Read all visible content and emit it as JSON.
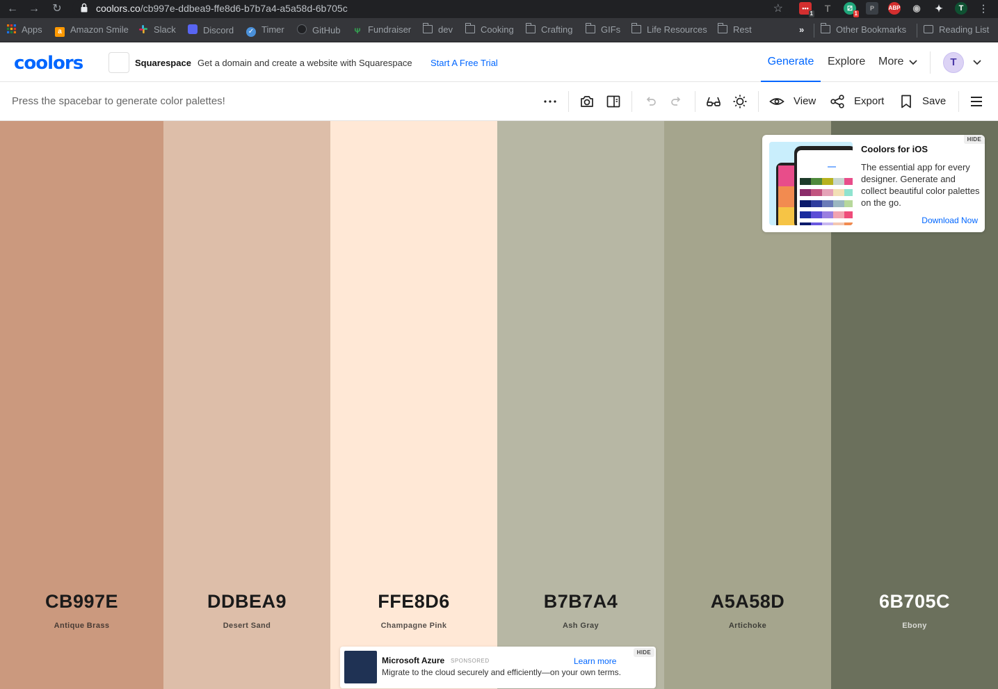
{
  "browser": {
    "url_host": "coolors.co",
    "url_path": "/cb997e-ddbea9-ffe8d6-b7b7a4-a5a58d-6b705c",
    "extension_badges": [
      "1",
      "1"
    ],
    "avatar_letter": "T"
  },
  "bookmarks": {
    "items": [
      {
        "label": "Apps",
        "icon": "apps-grid-icon"
      },
      {
        "label": "Amazon Smile",
        "icon": "amazon-icon"
      },
      {
        "label": "Slack",
        "icon": "slack-icon"
      },
      {
        "label": "Discord",
        "icon": "discord-icon"
      },
      {
        "label": "Timer",
        "icon": "timer-check-icon"
      },
      {
        "label": "GitHub",
        "icon": "github-icon"
      },
      {
        "label": "Fundraiser",
        "icon": "fundraiser-icon"
      },
      {
        "label": "dev",
        "icon": "folder-icon"
      },
      {
        "label": "Cooking",
        "icon": "folder-icon"
      },
      {
        "label": "Crafting",
        "icon": "folder-icon"
      },
      {
        "label": "GIFs",
        "icon": "folder-icon"
      },
      {
        "label": "Life Resources",
        "icon": "folder-icon"
      },
      {
        "label": "Rest",
        "icon": "folder-icon"
      }
    ],
    "overflow": "»",
    "other": "Other Bookmarks",
    "reading_list": "Reading List"
  },
  "header": {
    "logo": "coolors",
    "ad_brand": "Squarespace",
    "ad_text": "Get a domain and create a website with Squarespace",
    "ad_link": "Start A Free Trial",
    "nav": {
      "generate": "Generate",
      "explore": "Explore",
      "more": "More"
    },
    "avatar": "T"
  },
  "toolbar": {
    "hint": "Press the spacebar to generate color palettes!",
    "view": "View",
    "export": "Export",
    "save": "Save"
  },
  "palette": [
    {
      "hex": "CB997E",
      "name": "Antique Brass",
      "color": "#cb997e",
      "text_color": "#1a1a1a"
    },
    {
      "hex": "DDBEA9",
      "name": "Desert Sand",
      "color": "#ddbea9",
      "text_color": "#1a1a1a"
    },
    {
      "hex": "FFE8D6",
      "name": "Champagne Pink",
      "color": "#ffe8d6",
      "text_color": "#1a1a1a"
    },
    {
      "hex": "B7B7A4",
      "name": "Ash Gray",
      "color": "#b7b7a4",
      "text_color": "#1a1a1a"
    },
    {
      "hex": "A5A58D",
      "name": "Artichoke",
      "color": "#a5a58d",
      "text_color": "#1a1a1a"
    },
    {
      "hex": "6B705C",
      "name": "Ebony",
      "color": "#6b705c",
      "text_color": "#ffffff"
    }
  ],
  "ios_promo": {
    "hide": "HIDE",
    "title": "Coolors for iOS",
    "description": "The essential app for every designer. Generate and collect beautiful color palettes on the go.",
    "link": "Download Now"
  },
  "azure_ad": {
    "hide": "HIDE",
    "title": "Microsoft Azure",
    "sponsored": "SPONSORED",
    "link": "Learn more",
    "description": "Migrate to the cloud securely and efficiently—on your own terms."
  }
}
